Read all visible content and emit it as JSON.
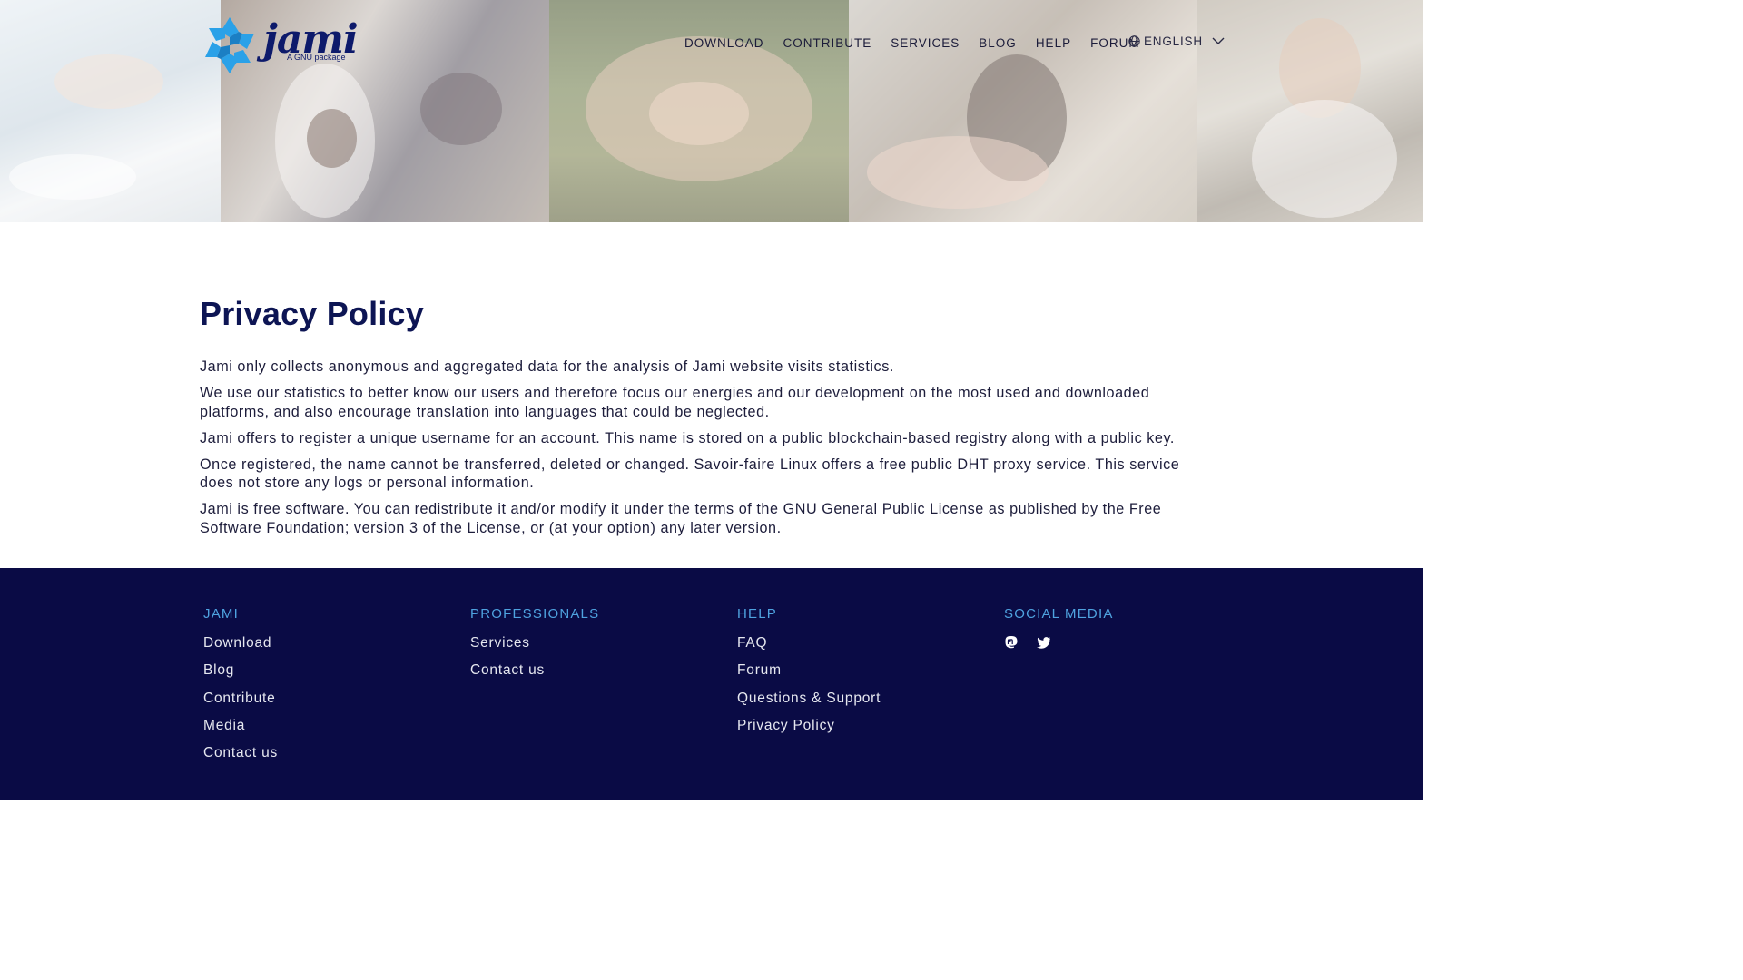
{
  "header": {
    "logo_word": "jami",
    "logo_sub": "A GNU package",
    "nav": [
      "DOWNLOAD",
      "CONTRIBUTE",
      "SERVICES",
      "BLOG",
      "HELP",
      "FORUM"
    ],
    "language": "ENGLISH"
  },
  "main": {
    "title": "Privacy Policy",
    "paragraphs": [
      "Jami only collects anonymous and aggregated data for the analysis of Jami website visits statistics.",
      "We use our statistics to better know our users and therefore focus our energies and our development on the most used and downloaded platforms, and also encourage translation into languages that could be neglected.",
      "Jami offers to register a unique username for an account. This name is stored on a public blockchain-based registry along with a public key.",
      "Once registered, the name cannot be transferred, deleted or changed. Savoir-faire Linux offers a free public DHT proxy service. This service does not store any logs or personal information.",
      "Jami is free software. You can redistribute it and/or modify it under the terms of the GNU General Public License as published by the Free Software Foundation; version 3 of the License, or (at your option) any later version."
    ]
  },
  "footer": {
    "columns": [
      {
        "heading": "JAMI",
        "links": [
          "Download",
          "Blog",
          "Contribute",
          "Media",
          "Contact us"
        ]
      },
      {
        "heading": "PROFESSIONALS",
        "links": [
          "Services",
          "Contact us"
        ]
      },
      {
        "heading": "HELP",
        "links": [
          "FAQ",
          "Forum",
          "Questions & Support",
          "Privacy Policy"
        ]
      },
      {
        "heading": "SOCIAL MEDIA",
        "icons": [
          "mastodon-icon",
          "twitter-icon"
        ]
      }
    ]
  },
  "colors": {
    "brand_dark": "#0d1554",
    "footer_bg": "#0a0b45",
    "footer_heading": "#4fa3e0",
    "logo_blue": "#2aa1e8"
  }
}
